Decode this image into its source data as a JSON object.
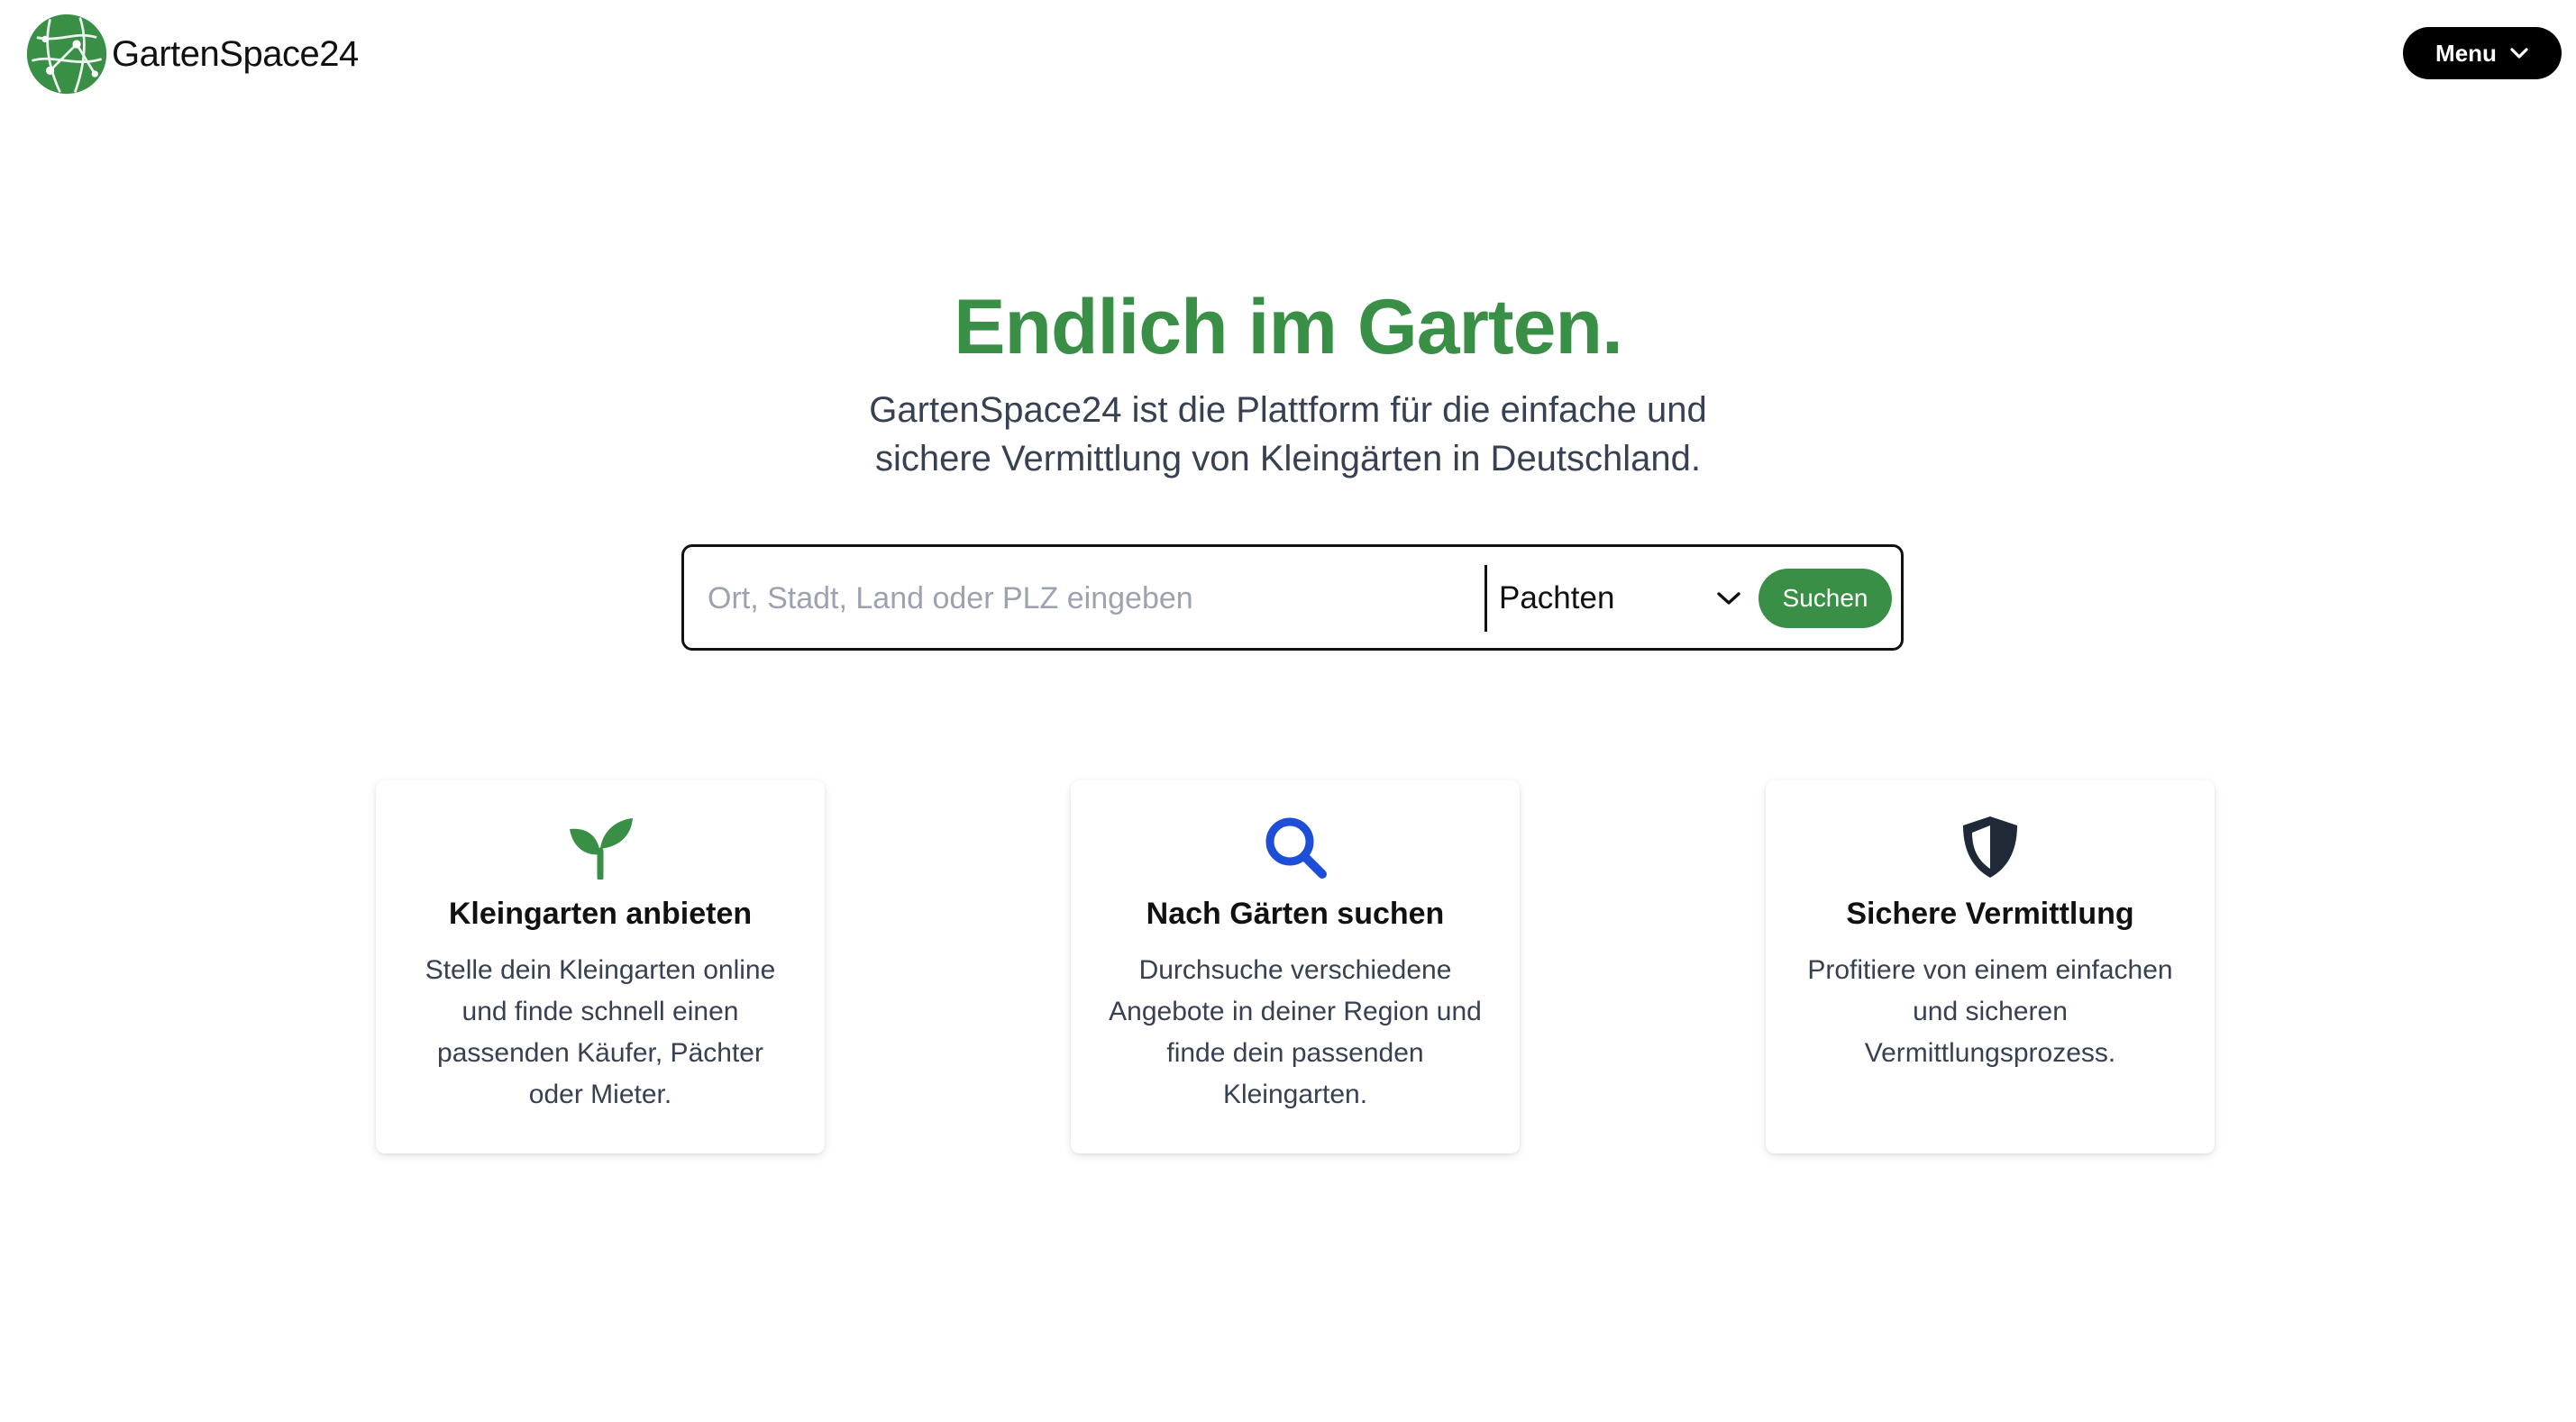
{
  "header": {
    "brand_name": "GartenSpace24",
    "menu_label": "Menu"
  },
  "hero": {
    "title": "Endlich im Garten.",
    "subtitle_line1": "GartenSpace24 ist die Plattform für die einfache und",
    "subtitle_line2": "sichere Vermittlung von Kleingärten in Deutschland."
  },
  "search": {
    "placeholder": "Ort, Stadt, Land oder PLZ eingeben",
    "value": "",
    "type_selected": "Pachten",
    "submit_label": "Suchen"
  },
  "features": [
    {
      "icon": "sprout-icon",
      "title": "Kleingarten anbieten",
      "text": "Stelle dein Kleingarten online und finde schnell einen passenden Käufer, Pächter oder Mieter."
    },
    {
      "icon": "search-icon",
      "title": "Nach Gärten suchen",
      "text": "Durchsuche verschiedene Angebote in deiner Region und finde dein passenden Kleingarten."
    },
    {
      "icon": "shield-icon",
      "title": "Sichere Vermittlung",
      "text": "Profitiere von einem einfachen und sicheren Vermittlungsprozess."
    }
  ],
  "colors": {
    "brand_green": "#3a8f47",
    "search_icon_blue": "#1d4ed8",
    "shield_dark": "#1f2937",
    "menu_black": "#000000"
  }
}
